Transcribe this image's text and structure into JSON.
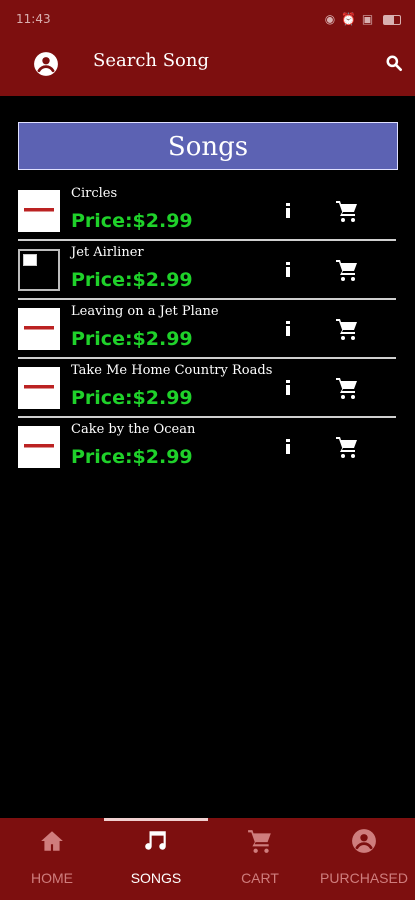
{
  "status": {
    "time": "11:43",
    "right": "◉ ⏰ ▣"
  },
  "header": {
    "title": "Search Song",
    "avatar_icon": "account-circle-icon",
    "search_icon": "search-icon"
  },
  "section_title": "Songs",
  "songs": [
    {
      "title": "Circles",
      "price": "Price:$2.99"
    },
    {
      "title": "Jet Airliner",
      "price": "Price:$2.99"
    },
    {
      "title": "Leaving on a Jet Plane",
      "price": "Price:$2.99"
    },
    {
      "title": "Take Me Home Country Roads",
      "price": "Price:$2.99"
    },
    {
      "title": "Cake by the Ocean",
      "price": "Price:$2.99"
    }
  ],
  "nav": {
    "home": "HOME",
    "songs": "SONGS",
    "cart": "CART",
    "purchased": "PURCHASED",
    "active": "SONGS"
  },
  "colors": {
    "appbar": "#7d0f0f",
    "section_header": "#5c62b3",
    "price": "#1fd12a",
    "nav_inactive": "#cf7d7d"
  }
}
